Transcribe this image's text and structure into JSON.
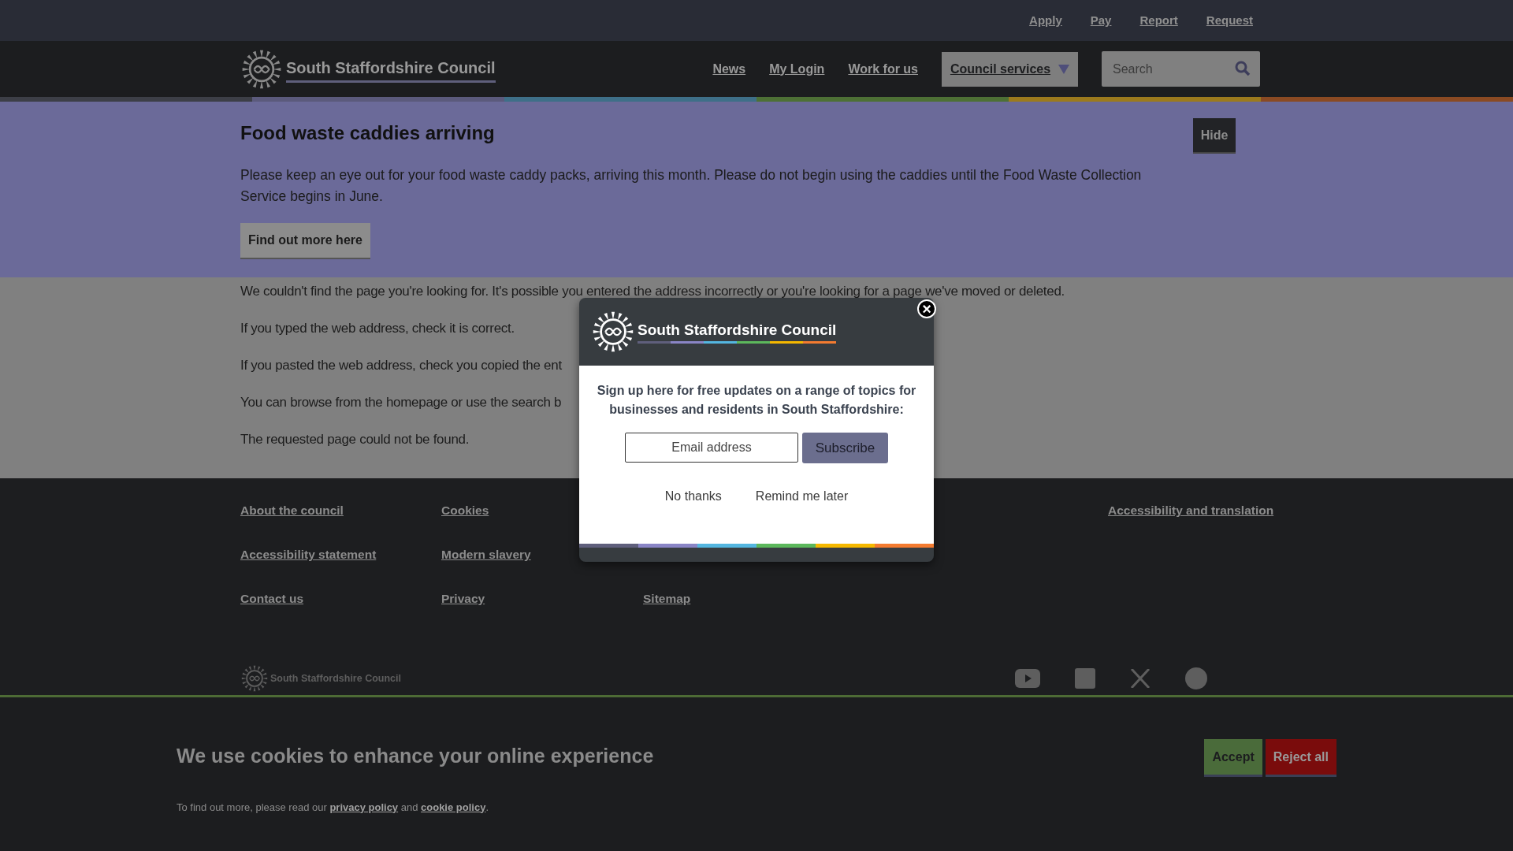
{
  "utility_links": [
    "Apply",
    "Pay",
    "Report",
    "Request"
  ],
  "header": {
    "logo_text": "South Staffordshire Council",
    "nav": [
      "News",
      "My Login",
      "Work for us"
    ],
    "services_menu": {
      "label": "Council services",
      "expanded": false
    },
    "search": {
      "placeholder": "Search"
    }
  },
  "alert": {
    "title": "Food waste caddies arriving",
    "body": "Please keep an eye out for your food waste caddy packs, arriving this month. Please do not begin using the caddies until the Food Waste Collection Service begins in June.",
    "button": "Find out more here",
    "hide": "Hide"
  },
  "content": {
    "paragraphs": [
      "We couldn't find the page you're looking for. It's possible you entered the address incorrectly or you're looking for a page we've moved or deleted.",
      "If you typed the web address, check it is correct.",
      "If you pasted the web address, check you copied the ent",
      "You can browse from the homepage or use the search b",
      "The requested page could not be found."
    ]
  },
  "footer": {
    "columns": [
      [
        "About the council",
        "Accessibility statement",
        "Contact us"
      ],
      [
        "Cookies",
        "Modern slavery",
        "Privacy"
      ],
      [
        "Sitemap"
      ],
      [
        "Accessibility and translation"
      ]
    ],
    "logo_text": "South Staffordshire Council"
  },
  "popup": {
    "logo_text": "South Staffordshire Council",
    "message": "Sign up here for free updates on a range of topics for businesses and residents in South Staffordshire:",
    "email": {
      "placeholder": "Email address"
    },
    "subscribe": "Subscribe",
    "no_thanks": "No thanks",
    "remind": "Remind me later",
    "close": "×"
  },
  "cookie_banner": {
    "title": "We use cookies to enhance your online experience",
    "body": [
      {
        "kind": "text",
        "text": "To find out more, please read our "
      },
      {
        "kind": "link",
        "text": "privacy policy"
      },
      {
        "kind": "text",
        "text": " and "
      },
      {
        "kind": "link",
        "text": "cookie policy"
      },
      {
        "kind": "text",
        "text": "."
      }
    ],
    "accept": "Accept",
    "reject": "Reject all"
  }
}
